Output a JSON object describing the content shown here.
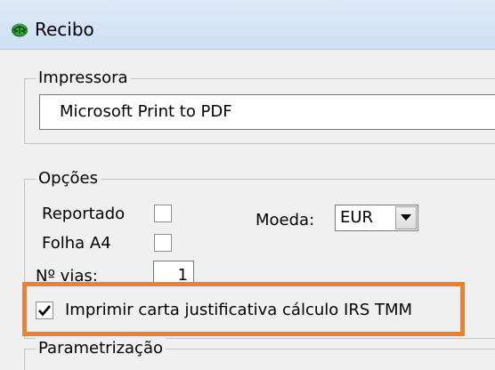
{
  "window": {
    "title": "Recibo",
    "icon": "logo-icon"
  },
  "printer_group": {
    "label": "Impressora",
    "selected_printer": "Microsoft Print to PDF"
  },
  "options_group": {
    "label": "Opções",
    "reportado": {
      "label": "Reportado",
      "checked": false
    },
    "folha_a4": {
      "label": "Folha A4",
      "checked": false
    },
    "num_vias": {
      "label": "Nº vias:",
      "value": "1"
    },
    "moeda": {
      "label": "Moeda:",
      "value": "EUR"
    },
    "carta_irs": {
      "label": "Imprimir carta justificativa cálculo IRS TMM",
      "checked": true
    }
  },
  "params_group": {
    "label": "Parametrização"
  },
  "colors": {
    "highlight": "#f57e26",
    "titlebar": "#d6e5f6",
    "client_bg": "#f0f0f0"
  }
}
